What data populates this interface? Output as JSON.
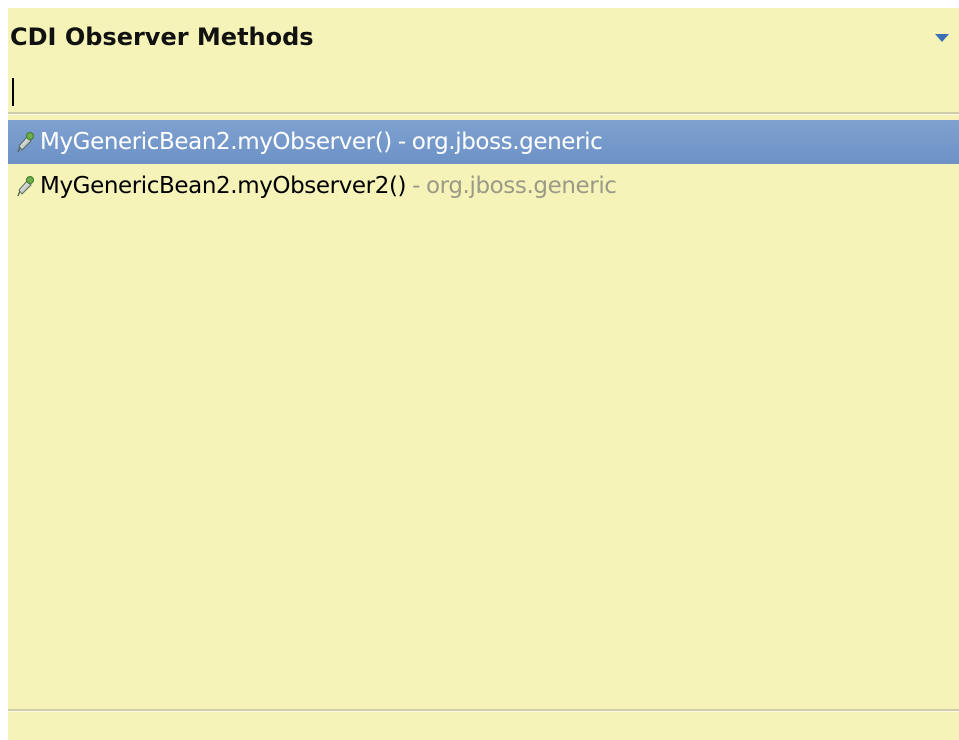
{
  "popup": {
    "title": "CDI Observer Methods",
    "menu_icon": "chevron-down-icon",
    "filter": {
      "value": "",
      "placeholder": ""
    },
    "items": [
      {
        "icon": "method-icon",
        "label": "MyGenericBean2.myObserver()",
        "separator": "-",
        "package": "org.jboss.generic",
        "selected": true
      },
      {
        "icon": "method-icon",
        "label": "MyGenericBean2.myObserver2()",
        "separator": "-",
        "package": "org.jboss.generic",
        "selected": false
      }
    ],
    "colors": {
      "background": "#f5f3b8",
      "selection": "#7398c9",
      "package_text": "#9a9a86",
      "menu_arrow": "#3a6fb5"
    }
  }
}
